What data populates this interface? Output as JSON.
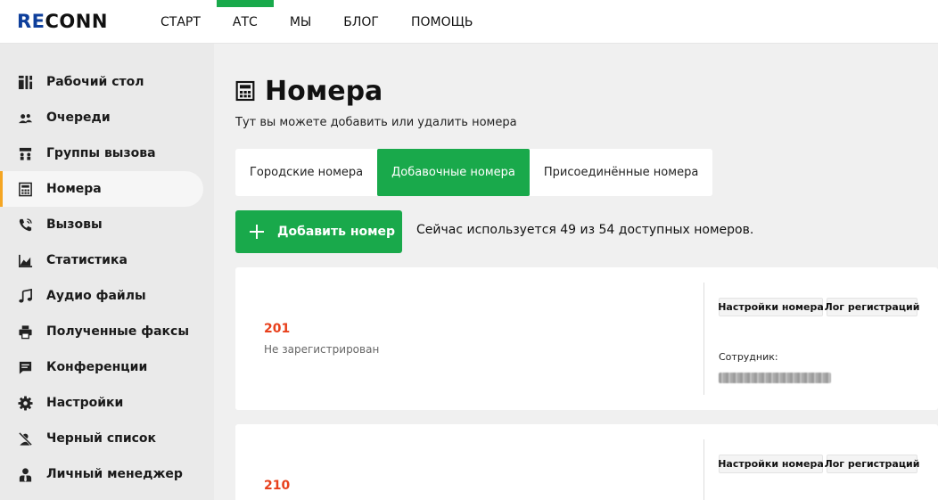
{
  "header": {
    "logo": {
      "part1": "RE",
      "part2": "CONN"
    },
    "nav": [
      {
        "label": "СТАРТ",
        "active": false
      },
      {
        "label": "АТС",
        "active": true
      },
      {
        "label": "МЫ",
        "active": false
      },
      {
        "label": "БЛОГ",
        "active": false
      },
      {
        "label": "ПОМОЩЬ",
        "active": false
      }
    ]
  },
  "sidebar": {
    "items": [
      {
        "label": "Рабочий стол",
        "icon": "dashboard-icon"
      },
      {
        "label": "Очереди",
        "icon": "queue-icon"
      },
      {
        "label": "Группы вызова",
        "icon": "call-group-icon"
      },
      {
        "label": "Номера",
        "icon": "numbers-icon",
        "active": true
      },
      {
        "label": "Вызовы",
        "icon": "phone-call-icon"
      },
      {
        "label": "Статистика",
        "icon": "chart-icon"
      },
      {
        "label": "Аудио файлы",
        "icon": "music-note-icon"
      },
      {
        "label": "Полученные факсы",
        "icon": "printer-icon"
      },
      {
        "label": "Конференции",
        "icon": "chat-icon"
      },
      {
        "label": "Настройки",
        "icon": "gear-icon"
      },
      {
        "label": "Черный список",
        "icon": "blocked-user-icon"
      },
      {
        "label": "Личный менеджер",
        "icon": "manager-icon"
      }
    ]
  },
  "main": {
    "title": "Номера",
    "subtitle": "Тут вы можете добавить или удалить номера",
    "tabs": [
      {
        "label": "Городские номера",
        "active": false
      },
      {
        "label": "Добавочные номера",
        "active": true
      },
      {
        "label": "Присоединённые номера",
        "active": false
      }
    ],
    "add_button": "Добавить номер",
    "usage_text": "Сейчас используется 49 из 54 доступных номеров.",
    "extensions": [
      {
        "number": "201",
        "status": "Не зарегистрирован",
        "settings_btn": "Настройки номера",
        "log_btn": "Лог регистраций",
        "employee_label": "Сотрудник:"
      },
      {
        "number": "210",
        "settings_btn": "Настройки номера",
        "log_btn": "Лог регистраций"
      }
    ]
  },
  "colors": {
    "accent_green": "#19a94b",
    "number_red": "#e8401c",
    "active_marker": "#f5a623",
    "logo_blue": "#0e3f9b"
  }
}
